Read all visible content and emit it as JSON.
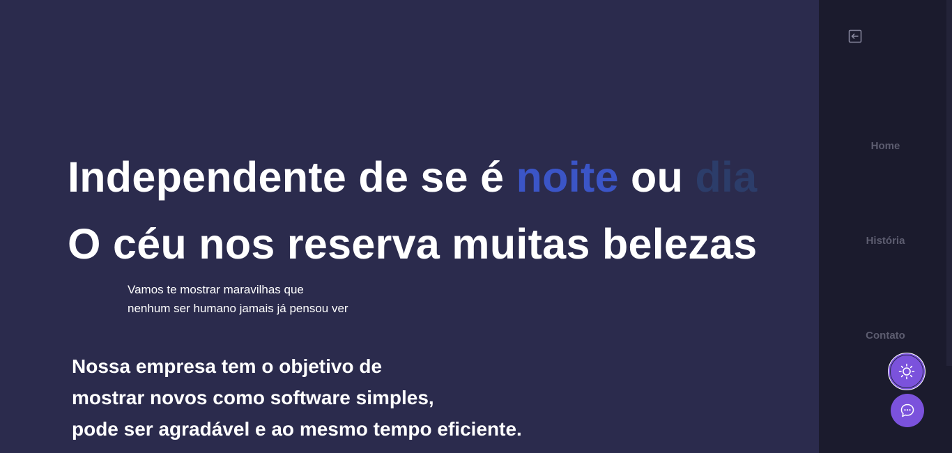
{
  "hero": {
    "line1_start": "Independente de se é ",
    "line1_night": "noite",
    "line1_mid": " ou ",
    "line1_day": "dia",
    "line2": "O céu nos reserva muitas belezas"
  },
  "subtitle": {
    "line1": "Vamos te mostrar maravilhas que",
    "line2": "nenhum ser humano jamais já pensou ver"
  },
  "mission": {
    "line1": "Nossa empresa tem o objetivo de",
    "line2": "mostrar novos como software simples,",
    "line3": "pode ser agradável e ao mesmo tempo eficiente."
  },
  "sidebar": {
    "collapse_icon": "arrow-left-box-icon",
    "items": [
      {
        "label": "Home"
      },
      {
        "label": "História"
      },
      {
        "label": "Contato"
      }
    ]
  },
  "floating_buttons": {
    "theme_icon": "sun-icon",
    "chat_icon": "chat-bubble-icon"
  },
  "colors": {
    "background": "#2b2b4d",
    "sidebar": "#1b1b2d",
    "night_accent": "#3b55c7",
    "day_accent": "#2c3d6a",
    "button": "#7b52dc",
    "nav_text": "#5d5d70"
  }
}
